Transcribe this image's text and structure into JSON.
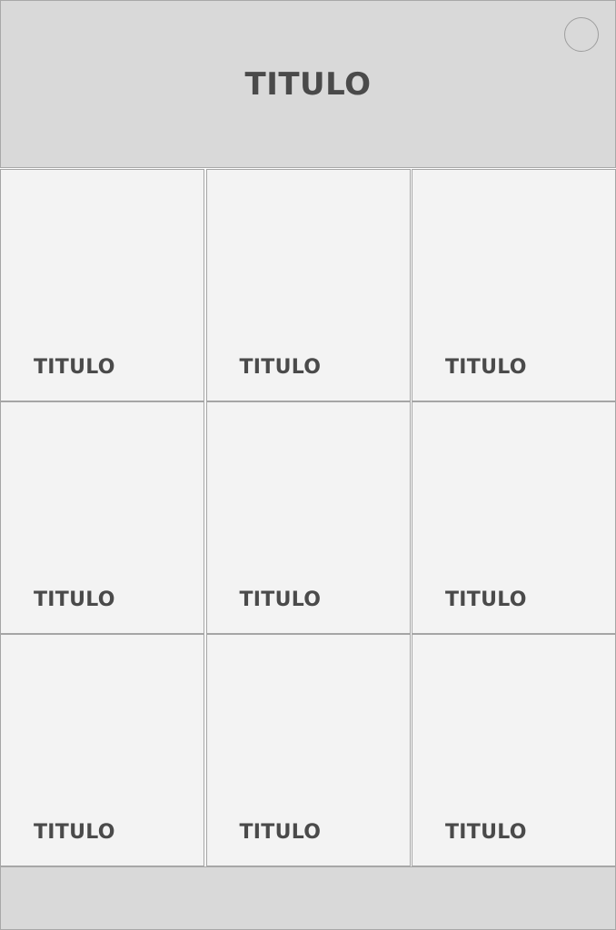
{
  "header": {
    "title": "TITULO",
    "action_icon": "circle-button-icon"
  },
  "tiles": [
    {
      "label": "TITULO"
    },
    {
      "label": "TITULO"
    },
    {
      "label": "TITULO"
    },
    {
      "label": "TITULO"
    },
    {
      "label": "TITULO"
    },
    {
      "label": "TITULO"
    },
    {
      "label": "TITULO"
    },
    {
      "label": "TITULO"
    },
    {
      "label": "TITULO"
    }
  ],
  "colors": {
    "header_bg": "#d9d9d9",
    "tile_bg": "#f3f3f3",
    "text": "#4a4a4a",
    "border": "#a5a5a5"
  }
}
